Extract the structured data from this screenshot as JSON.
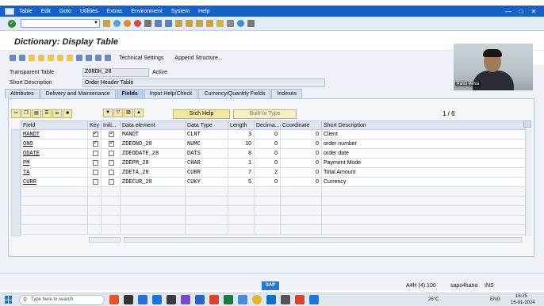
{
  "menu": {
    "items": [
      "Table",
      "Edit",
      "Goto",
      "Utilities",
      "Extras",
      "Environment",
      "System",
      "Help"
    ]
  },
  "title": "Dictionary: Display Table",
  "appbar": {
    "technical_settings": "Technical Settings",
    "append_structure": "Append Structure..."
  },
  "header": {
    "transparent_table_label": "Transparent Table",
    "transparent_table_value": "ZORDH_28",
    "status": "Active",
    "short_description_label": "Short Description",
    "short_description_value": "Order Header Table"
  },
  "tabs": [
    "Attributes",
    "Delivery and Maintenance",
    "Fields",
    "Input Help/Check",
    "Currency/Quantity Fields",
    "Indexes"
  ],
  "active_tab": "Fields",
  "buttons": {
    "srch_help": "Srch Help",
    "built_in_type": "Built-In Type"
  },
  "page_indicator": "1 / 6",
  "table": {
    "columns": [
      "Field",
      "Key",
      "Initi...",
      "Data element",
      "Data Type",
      "Length",
      "Decima...",
      "Coordinate",
      "Short Description"
    ],
    "rows": [
      {
        "field": "MANDT",
        "key": true,
        "init": true,
        "data_element": "MANDT",
        "data_type": "CLNT",
        "length": "3",
        "decimals": "0",
        "coordinate": "0",
        "short_desc": "Client"
      },
      {
        "field": "ONO",
        "key": true,
        "init": true,
        "data_element": "ZDEONO_28",
        "data_type": "NUMC",
        "length": "10",
        "decimals": "0",
        "coordinate": "0",
        "short_desc": "order number"
      },
      {
        "field": "ODATE",
        "key": false,
        "init": false,
        "data_element": "ZDEODATE_28",
        "data_type": "DATS",
        "length": "8",
        "decimals": "0",
        "coordinate": "0",
        "short_desc": "order date"
      },
      {
        "field": "PM",
        "key": false,
        "init": false,
        "data_element": "ZDEPM_28",
        "data_type": "CHAR",
        "length": "1",
        "decimals": "0",
        "coordinate": "0",
        "short_desc": "Payment Mode"
      },
      {
        "field": "TA",
        "key": false,
        "init": false,
        "data_element": "ZDETA_28",
        "data_type": "CURR",
        "length": "7",
        "decimals": "2",
        "coordinate": "0",
        "short_desc": "Total Amount"
      },
      {
        "field": "CURR",
        "key": false,
        "init": false,
        "data_element": "ZDECUR_28",
        "data_type": "CUKY",
        "length": "5",
        "decimals": "0",
        "coordinate": "0",
        "short_desc": "Currency"
      }
    ]
  },
  "status": {
    "system": "A4H (4) 100",
    "server": "saps4hana",
    "mode": "INS"
  },
  "taskbar": {
    "search_placeholder": "Type here to search",
    "weather": "26°C",
    "lang": "ENG",
    "time": "16:25",
    "date": "16-01-2024"
  },
  "webcam": {
    "name": "Rahul Mehta"
  }
}
